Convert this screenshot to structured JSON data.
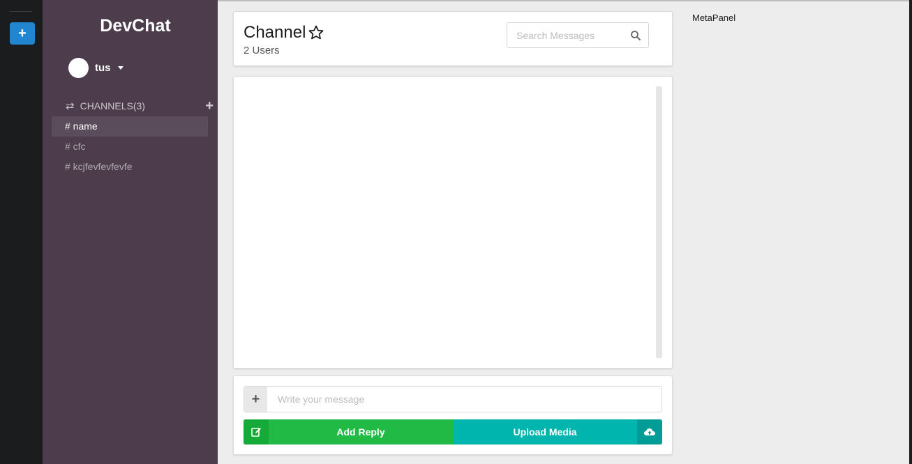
{
  "rail": {
    "add_label": "+"
  },
  "sidebar": {
    "brand": "DevChat",
    "user": {
      "name": "tus"
    },
    "channels_header": "CHANNELS(3)",
    "channels": [
      {
        "label": "# name",
        "active": true
      },
      {
        "label": "# cfc",
        "active": false
      },
      {
        "label": "# kcjfevfevfevfe",
        "active": false
      }
    ]
  },
  "header": {
    "title": "Channel",
    "users": "2 Users",
    "search_placeholder": "Search Messages"
  },
  "form": {
    "message_placeholder": "Write your message",
    "add_reply": "Add Reply",
    "upload_media": "Upload Media"
  },
  "metapanel": {
    "label": "MetaPanel"
  },
  "colors": {
    "rail": "#1b1c1d",
    "sidebar": "#4c3c4c",
    "primary": "#2185d0",
    "green": "#21ba45",
    "teal": "#00b5ad"
  }
}
